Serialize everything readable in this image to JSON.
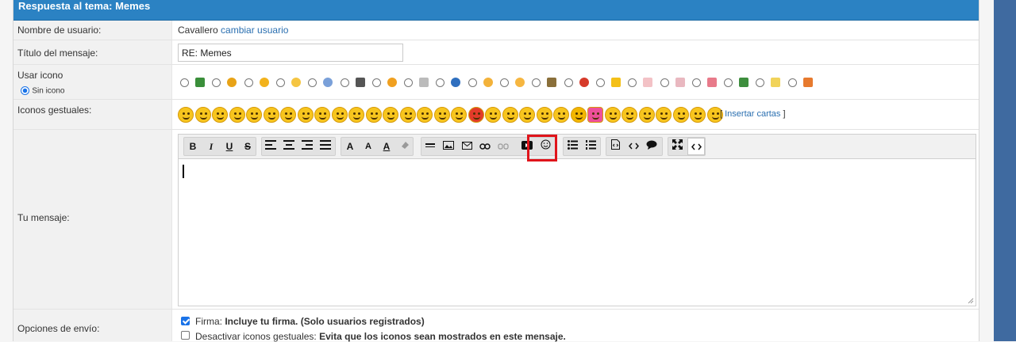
{
  "header": {
    "title": "Respuesta al tema: Memes"
  },
  "username_row": {
    "label": "Nombre de usuario:",
    "value": "Cavallero",
    "change_link": "cambiar usuario"
  },
  "title_row": {
    "label": "Título del mensaje:",
    "value": "RE: Memes"
  },
  "icon_row": {
    "label": "Usar icono",
    "none_option": "Sin icono",
    "icons": [
      "film-icon",
      "sad-face-icon",
      "smile-face-icon",
      "wink-face-icon",
      "question-icon",
      "music-note-icon",
      "tongue-face-icon",
      "cube-icon",
      "info-icon",
      "grin-face-icon",
      "laugh-face-icon",
      "picture-icon",
      "exclamation-icon",
      "star-icon",
      "thought-bubble-icon",
      "speech-bubble-icon",
      "heart-icon",
      "splat-icon",
      "lightbulb-icon",
      "rainbow-icon"
    ]
  },
  "smilies_row": {
    "label": "Iconos gestuales:",
    "insert_link": "Insertar cartas",
    "bracket_open": "[",
    "bracket_close": "]",
    "count": 32
  },
  "message_row": {
    "label": "Tu mensaje:"
  },
  "toolbar": {
    "bold": "B",
    "italic": "I",
    "underline": "U",
    "strike": "S",
    "font": "A",
    "size": "A",
    "color": "A"
  },
  "options_row": {
    "label": "Opciones de envío:",
    "signature": {
      "prefix": "Firma:",
      "text": "Incluye tu firma. (Solo usuarios registrados)",
      "checked": true
    },
    "disable_smilies": {
      "prefix": "Desactivar iconos gestuales:",
      "text": "Evita que los iconos sean mostrados en este mensaje.",
      "checked": false
    }
  },
  "colors": {
    "header_bg": "#2b82c3",
    "highlight": "#e0141b",
    "link": "#2a6fb0"
  }
}
